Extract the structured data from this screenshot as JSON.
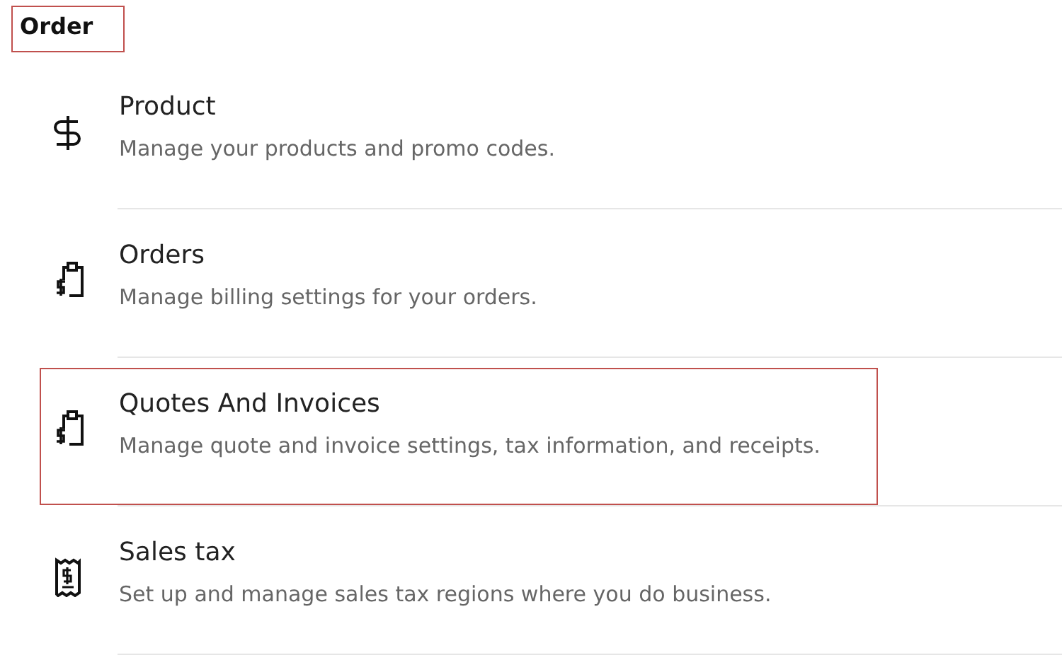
{
  "section": {
    "title": "Order",
    "highlighted": true
  },
  "items": [
    {
      "kind": "dollar",
      "title": "Product",
      "description": "Manage your products and promo codes.",
      "highlighted": false
    },
    {
      "kind": "clipboard",
      "title": "Orders",
      "description": "Manage billing settings for your orders.",
      "highlighted": false
    },
    {
      "kind": "clipboard",
      "title": "Quotes And Invoices",
      "description": "Manage quote and invoice settings, tax information, and receipts.",
      "highlighted": true
    },
    {
      "kind": "receipt",
      "title": "Sales tax",
      "description": "Set up and manage sales tax regions where you do business.",
      "highlighted": false
    }
  ]
}
